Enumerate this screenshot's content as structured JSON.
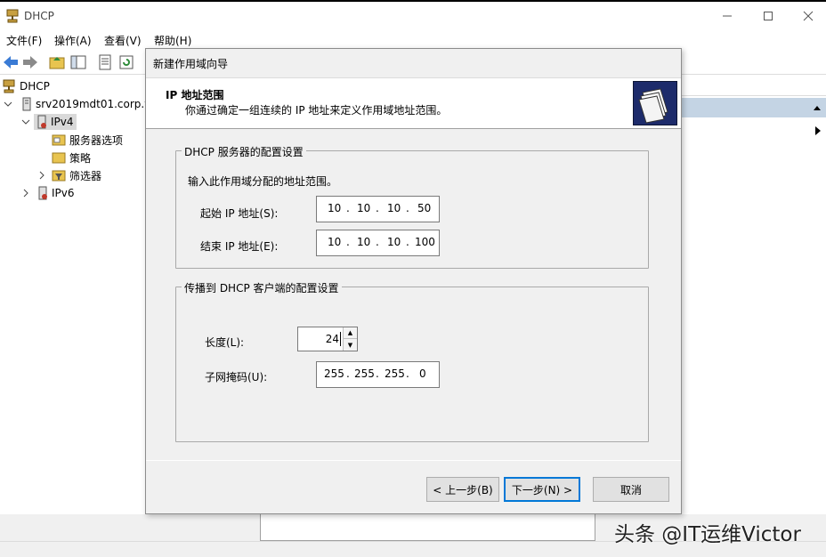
{
  "window": {
    "title": "DHCP"
  },
  "menu": [
    "文件(F)",
    "操作(A)",
    "查看(V)",
    "帮助(H)"
  ],
  "tree": {
    "root": "DHCP",
    "server": "srv2019mdt01.corp.v",
    "ipv4": "IPv4",
    "children": [
      "服务器选项",
      "策略",
      "筛选器"
    ],
    "ipv6": "IPv6"
  },
  "dialog": {
    "title": "新建作用域向导",
    "header_title": "IP 地址范围",
    "header_subtitle": "你通过确定一组连续的 IP 地址来定义作用域地址范围。",
    "group1": {
      "title": "DHCP 服务器的配置设置",
      "instruction": "输入此作用域分配的地址范围。",
      "start_label": "起始 IP 地址(S):",
      "start_ip": [
        "10",
        "10",
        "10",
        "50"
      ],
      "end_label": "结束 IP 地址(E):",
      "end_ip": [
        "10",
        "10",
        "10",
        "100"
      ]
    },
    "group2": {
      "title": "传播到 DHCP 客户端的配置设置",
      "length_label": "长度(L):",
      "length_value": "24",
      "mask_label": "子网掩码(U):",
      "mask": [
        "255",
        "255",
        "255",
        "0"
      ]
    },
    "buttons": {
      "back": "< 上一步(B)",
      "next": "下一步(N) >",
      "cancel": "取消"
    }
  },
  "watermark": "头条 @IT运维Victor",
  "colors": {
    "selection": "#d9d9d9",
    "action_bar": "#c4d4e4",
    "dialog_bg": "#f0f0f0",
    "focus_border": "#0078d7",
    "wizard_icon_bg": "#1d2b6b"
  }
}
